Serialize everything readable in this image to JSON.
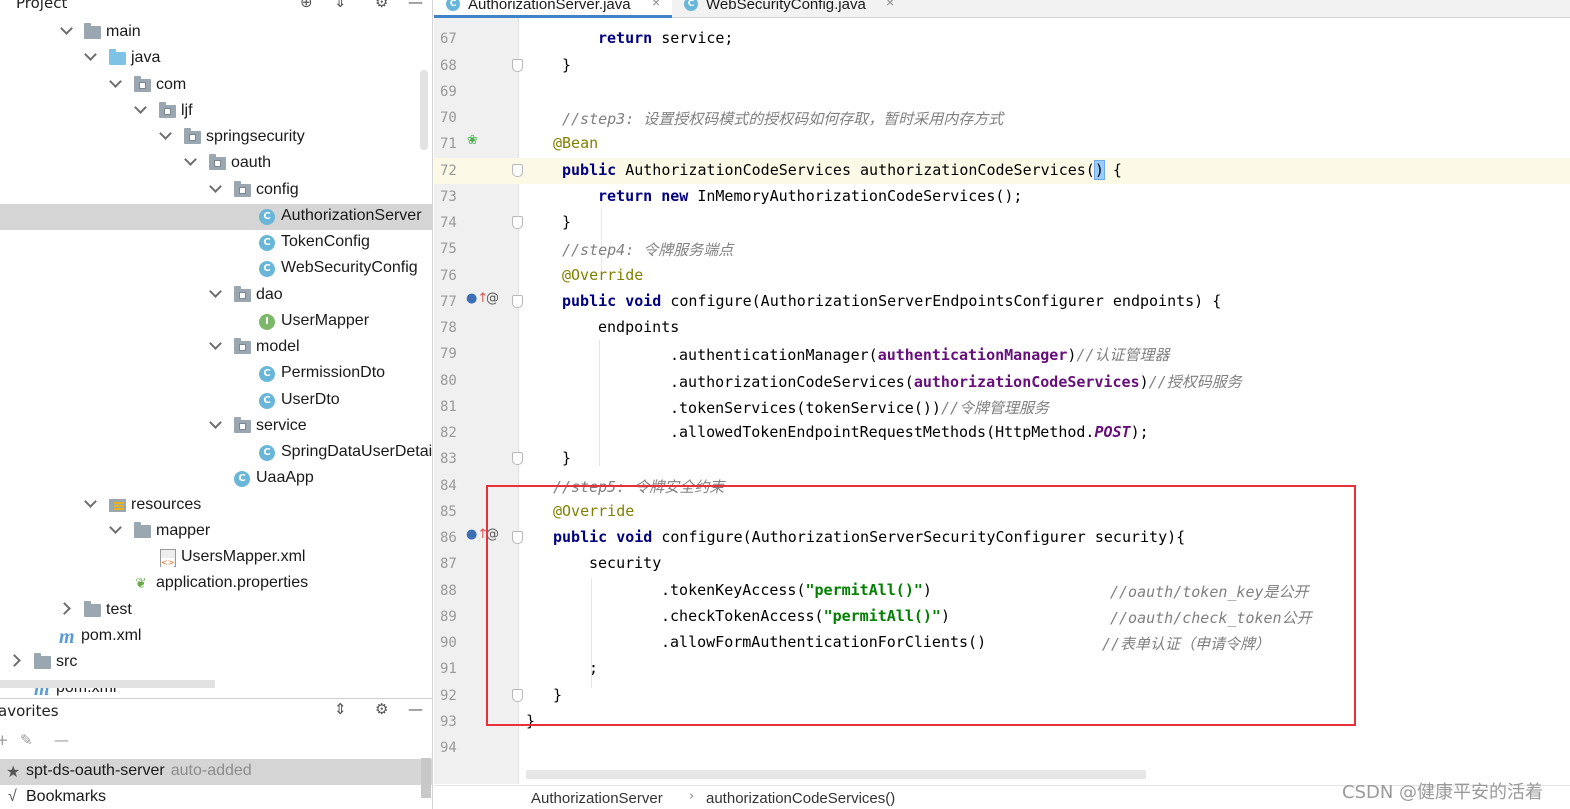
{
  "project_panel": {
    "title": "Project",
    "tree": [
      {
        "label": "main",
        "kind": "folder"
      },
      {
        "label": "java",
        "kind": "folder-src"
      },
      {
        "label": "com",
        "kind": "package"
      },
      {
        "label": "ljf",
        "kind": "package"
      },
      {
        "label": "springsecurity",
        "kind": "package"
      },
      {
        "label": "oauth",
        "kind": "package"
      },
      {
        "label": "config",
        "kind": "package"
      },
      {
        "label": "AuthorizationServer",
        "kind": "class",
        "badge": "C",
        "selected": true
      },
      {
        "label": "TokenConfig",
        "kind": "class",
        "badge": "C"
      },
      {
        "label": "WebSecurityConfig",
        "kind": "class",
        "badge": "C"
      },
      {
        "label": "dao",
        "kind": "package"
      },
      {
        "label": "UserMapper",
        "kind": "interface",
        "badge": "I"
      },
      {
        "label": "model",
        "kind": "package"
      },
      {
        "label": "PermissionDto",
        "kind": "class",
        "badge": "C"
      },
      {
        "label": "UserDto",
        "kind": "class",
        "badge": "C"
      },
      {
        "label": "service",
        "kind": "package"
      },
      {
        "label": "SpringDataUserDetai",
        "kind": "class",
        "badge": "C"
      },
      {
        "label": "UaaApp",
        "kind": "app-class",
        "badge": "C"
      },
      {
        "label": "resources",
        "kind": "resources"
      },
      {
        "label": "mapper",
        "kind": "package"
      },
      {
        "label": "UsersMapper.xml",
        "kind": "xml"
      },
      {
        "label": "application.properties",
        "kind": "properties"
      },
      {
        "label": "test",
        "kind": "folder"
      },
      {
        "label": "pom.xml",
        "kind": "maven"
      },
      {
        "label": "src",
        "kind": "folder"
      },
      {
        "label": "pom.xml",
        "kind": "maven"
      }
    ]
  },
  "favorites_panel": {
    "title": "avorites",
    "items": [
      {
        "label": "spt-ds-oauth-server",
        "hint": "auto-added",
        "icon": "star-icon"
      },
      {
        "label": "Bookmarks",
        "icon": "check-icon"
      }
    ]
  },
  "tabs": [
    {
      "label": "AuthorizationServer.java",
      "active": true
    },
    {
      "label": "WebSecurityConfig.java",
      "active": false
    }
  ],
  "editor": {
    "current_line": "72",
    "lines": [
      {
        "num": "67"
      },
      {
        "num": "68"
      },
      {
        "num": "69"
      },
      {
        "num": "70"
      },
      {
        "num": "71"
      },
      {
        "num": "72"
      },
      {
        "num": "73"
      },
      {
        "num": "74"
      },
      {
        "num": "75"
      },
      {
        "num": "76"
      },
      {
        "num": "77"
      },
      {
        "num": "78"
      },
      {
        "num": "79"
      },
      {
        "num": "80"
      },
      {
        "num": "81"
      },
      {
        "num": "82"
      },
      {
        "num": "83"
      },
      {
        "num": "84"
      },
      {
        "num": "85"
      },
      {
        "num": "86"
      },
      {
        "num": "87"
      },
      {
        "num": "88"
      },
      {
        "num": "89"
      },
      {
        "num": "90"
      },
      {
        "num": "91"
      },
      {
        "num": "92"
      },
      {
        "num": "93"
      },
      {
        "num": "94"
      }
    ],
    "code": {
      "l67_kw": "return",
      "l67_rest": " service;",
      "l68": "}",
      "l70": "//step3: 设置授权码模式的授权码如何存取，暂时采用内存方式",
      "l71": "@Bean",
      "l72_kw": "public",
      "l72_a": " AuthorizationCodeServices authorizationCodeServices(",
      "l72_b": ")",
      "l72_c": " {",
      "l73_kw": "return new",
      "l73_rest": " InMemoryAuthorizationCodeServices();",
      "l74": "}",
      "l75": "//step4: 令牌服务端点",
      "l76": "@Override",
      "l77_kw": "public void",
      "l77_rest": " configure(AuthorizationServerEndpointsConfigurer endpoints) {",
      "l78": "endpoints",
      "l79_a": ".authenticationManager(",
      "l79_f": "authenticationManager",
      "l79_b": ")",
      "l79_c": "//认证管理器",
      "l80_a": ".authorizationCodeServices(",
      "l80_f": "authorizationCodeServices",
      "l80_b": ")",
      "l80_c": "//授权码服务",
      "l81_a": ".tokenServices(tokenService())",
      "l81_c": "//令牌管理服务",
      "l82_a": ".allowedTokenEndpointRequestMethods(HttpMethod.",
      "l82_f": "POST",
      "l82_b": ");",
      "l83": "}",
      "l84": "//step5: 令牌安全约束",
      "l85": "@Override",
      "l86_kw": "public void",
      "l86_rest": " configure(AuthorizationServerSecurityConfigurer security){",
      "l87": "security",
      "l88_a": ".tokenKeyAccess(",
      "l88_s": "\"permitAll()\"",
      "l88_b": ")",
      "l88_c": "//oauth/token_key是公开",
      "l89_a": ".checkTokenAccess(",
      "l89_s": "\"permitAll()\"",
      "l89_b": ")",
      "l89_c": "//oauth/check_token公开",
      "l90_a": ".allowFormAuthenticationForClients()",
      "l90_c": "//表单认证（申请令牌）",
      "l91": ";",
      "l92": "}",
      "l93": "}"
    }
  },
  "breadcrumb": [
    "AuthorizationServer",
    "authorizationCodeServices()"
  ],
  "watermark": "CSDN @健康平安的活着",
  "colors": {
    "keyword": "#000080",
    "annotation": "#808000",
    "comment": "#808080",
    "field": "#660e7a",
    "string": "#008000",
    "highlight_box": "#e8303a",
    "current_line": "#fcfae6"
  }
}
